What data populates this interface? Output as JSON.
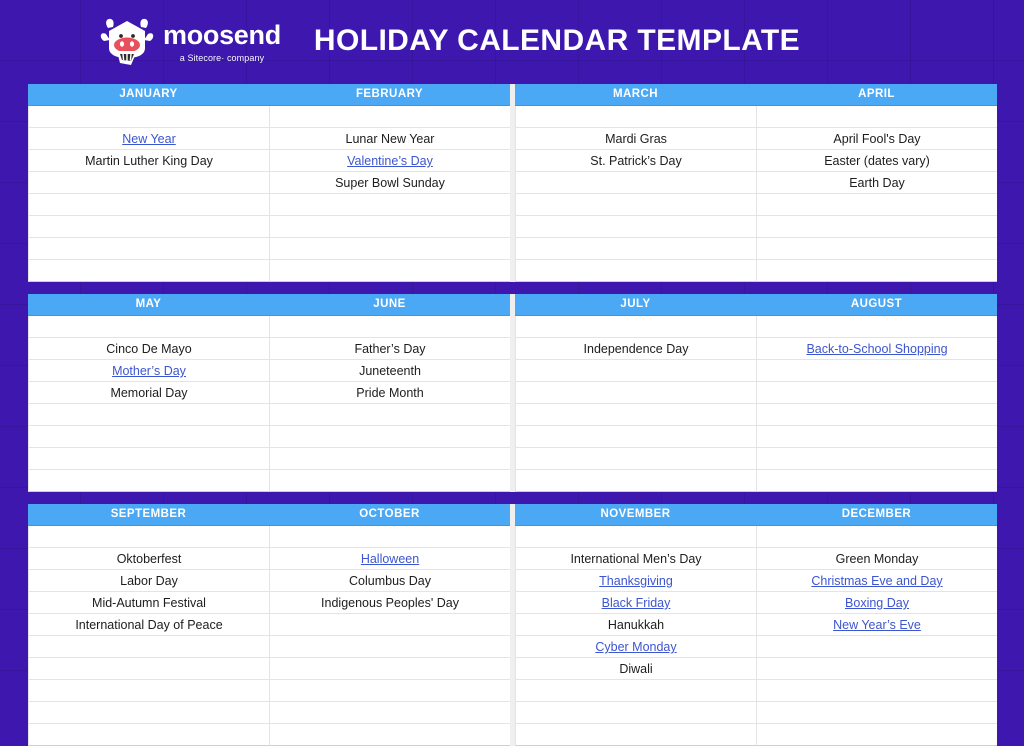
{
  "brand": {
    "wordmark": "moosend",
    "tagline": "a Sitecore· company",
    "logo_icon": "cow-mascot-icon",
    "logo_colors": {
      "body": "#ffffff",
      "nose": "#e8505c",
      "background": "#3d17ae"
    }
  },
  "header": {
    "title": "HOLIDAY CALENDAR TEMPLATE",
    "background": "#3d17ae",
    "text_color": "#ffffff"
  },
  "theme": {
    "page_background": "#3d17ae",
    "month_header_background": "#4aa8f5",
    "month_header_text": "#ffffff",
    "cell_background": "#ffffff",
    "cell_text": "#1d1d1d",
    "link_color": "#3d55cf",
    "grid_line": "#e4e4e4"
  },
  "calendar": {
    "rows_per_section": [
      8,
      8,
      10
    ],
    "sections": [
      {
        "months": [
          {
            "name": "JANUARY",
            "cells": [
              {
                "text": "",
                "link": false
              },
              {
                "text": "New Year",
                "link": true
              },
              {
                "text": "Martin Luther King Day",
                "link": false
              },
              {
                "text": "",
                "link": false
              },
              {
                "text": "",
                "link": false
              },
              {
                "text": "",
                "link": false
              },
              {
                "text": "",
                "link": false
              },
              {
                "text": "",
                "link": false
              }
            ]
          },
          {
            "name": "FEBRUARY",
            "cells": [
              {
                "text": "",
                "link": false
              },
              {
                "text": "Lunar New Year",
                "link": false
              },
              {
                "text": "Valentine’s Day",
                "link": true
              },
              {
                "text": "Super Bowl Sunday",
                "link": false
              },
              {
                "text": "",
                "link": false
              },
              {
                "text": "",
                "link": false
              },
              {
                "text": "",
                "link": false
              },
              {
                "text": "",
                "link": false
              }
            ]
          },
          {
            "name": "MARCH",
            "cells": [
              {
                "text": "",
                "link": false
              },
              {
                "text": "Mardi Gras",
                "link": false
              },
              {
                "text": "St. Patrick’s Day",
                "link": false
              },
              {
                "text": "",
                "link": false
              },
              {
                "text": "",
                "link": false
              },
              {
                "text": "",
                "link": false
              },
              {
                "text": "",
                "link": false
              },
              {
                "text": "",
                "link": false
              }
            ]
          },
          {
            "name": "APRIL",
            "cells": [
              {
                "text": "",
                "link": false
              },
              {
                "text": "April Fool's Day",
                "link": false
              },
              {
                "text": "Easter (dates vary)",
                "link": false
              },
              {
                "text": "Earth Day",
                "link": false
              },
              {
                "text": "",
                "link": false
              },
              {
                "text": "",
                "link": false
              },
              {
                "text": "",
                "link": false
              },
              {
                "text": "",
                "link": false
              }
            ]
          }
        ]
      },
      {
        "months": [
          {
            "name": "MAY",
            "cells": [
              {
                "text": "",
                "link": false
              },
              {
                "text": "Cinco De Mayo",
                "link": false
              },
              {
                "text": "Mother’s Day",
                "link": true
              },
              {
                "text": "Memorial Day",
                "link": false
              },
              {
                "text": "",
                "link": false
              },
              {
                "text": "",
                "link": false
              },
              {
                "text": "",
                "link": false
              },
              {
                "text": "",
                "link": false
              }
            ]
          },
          {
            "name": "JUNE",
            "cells": [
              {
                "text": "",
                "link": false
              },
              {
                "text": "Father’s Day",
                "link": false
              },
              {
                "text": "Juneteenth",
                "link": false
              },
              {
                "text": "Pride Month",
                "link": false
              },
              {
                "text": "",
                "link": false
              },
              {
                "text": "",
                "link": false
              },
              {
                "text": "",
                "link": false
              },
              {
                "text": "",
                "link": false
              }
            ]
          },
          {
            "name": "JULY",
            "cells": [
              {
                "text": "",
                "link": false
              },
              {
                "text": "Independence Day",
                "link": false
              },
              {
                "text": "",
                "link": false
              },
              {
                "text": "",
                "link": false
              },
              {
                "text": "",
                "link": false
              },
              {
                "text": "",
                "link": false
              },
              {
                "text": "",
                "link": false
              },
              {
                "text": "",
                "link": false
              }
            ]
          },
          {
            "name": "AUGUST",
            "cells": [
              {
                "text": "",
                "link": false
              },
              {
                "text": "Back-to-School Shopping",
                "link": true
              },
              {
                "text": "",
                "link": false
              },
              {
                "text": "",
                "link": false
              },
              {
                "text": "",
                "link": false
              },
              {
                "text": "",
                "link": false
              },
              {
                "text": "",
                "link": false
              },
              {
                "text": "",
                "link": false
              }
            ]
          }
        ]
      },
      {
        "months": [
          {
            "name": "SEPTEMBER",
            "cells": [
              {
                "text": "",
                "link": false
              },
              {
                "text": "Oktoberfest",
                "link": false
              },
              {
                "text": "Labor Day",
                "link": false
              },
              {
                "text": "Mid-Autumn Festival",
                "link": false
              },
              {
                "text": "International Day of Peace",
                "link": false
              },
              {
                "text": "",
                "link": false
              },
              {
                "text": "",
                "link": false
              },
              {
                "text": "",
                "link": false
              },
              {
                "text": "",
                "link": false
              },
              {
                "text": "",
                "link": false
              }
            ]
          },
          {
            "name": "OCTOBER",
            "cells": [
              {
                "text": "",
                "link": false
              },
              {
                "text": "Halloween",
                "link": true
              },
              {
                "text": "Columbus Day",
                "link": false
              },
              {
                "text": "Indigenous Peoples' Day",
                "link": false
              },
              {
                "text": "",
                "link": false
              },
              {
                "text": "",
                "link": false
              },
              {
                "text": "",
                "link": false
              },
              {
                "text": "",
                "link": false
              },
              {
                "text": "",
                "link": false
              },
              {
                "text": "",
                "link": false
              }
            ]
          },
          {
            "name": "NOVEMBER",
            "cells": [
              {
                "text": "",
                "link": false
              },
              {
                "text": "International Men’s Day",
                "link": false
              },
              {
                "text": "Thanksgiving",
                "link": true
              },
              {
                "text": "Black Friday",
                "link": true
              },
              {
                "text": "Hanukkah",
                "link": false
              },
              {
                "text": "Cyber Monday",
                "link": true
              },
              {
                "text": "Diwali",
                "link": false
              },
              {
                "text": "",
                "link": false
              },
              {
                "text": "",
                "link": false
              },
              {
                "text": "",
                "link": false
              }
            ]
          },
          {
            "name": "DECEMBER",
            "cells": [
              {
                "text": "",
                "link": false
              },
              {
                "text": "Green Monday",
                "link": false
              },
              {
                "text": "Christmas Eve and Day",
                "link": true
              },
              {
                "text": "Boxing Day",
                "link": true
              },
              {
                "text": "New Year’s Eve",
                "link": true
              },
              {
                "text": "",
                "link": false
              },
              {
                "text": "",
                "link": false
              },
              {
                "text": "",
                "link": false
              },
              {
                "text": "",
                "link": false
              },
              {
                "text": "",
                "link": false
              }
            ]
          }
        ]
      }
    ]
  }
}
